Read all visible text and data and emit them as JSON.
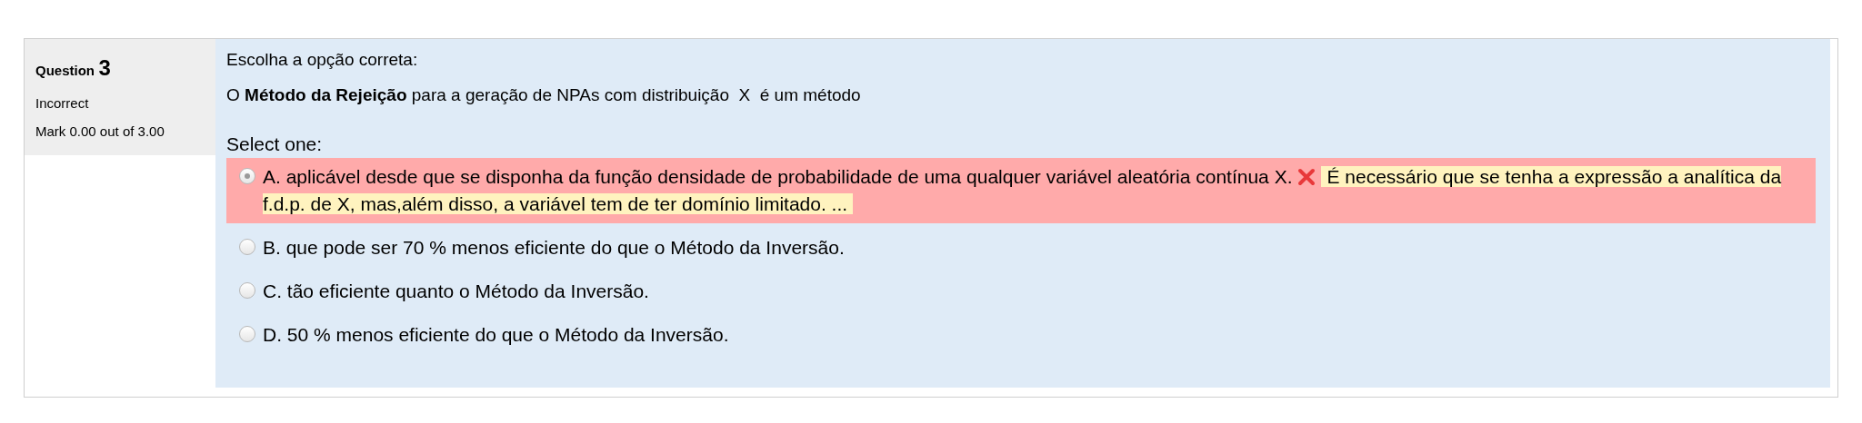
{
  "info": {
    "label": "Question",
    "number": "3",
    "status": "Incorrect",
    "mark": "Mark 0.00 out of 3.00"
  },
  "question": {
    "instruction": "Escolha a opção correta:",
    "text": "O **Método da Rejeição** para a geração de NPAs com distribuição  X  é um método",
    "prompt": "Select one:",
    "options": [
      {
        "text": "A. aplicável desde que se disponha da função densidade de probabilidade de uma qualquer variável aleatória contínua X.",
        "selected": true,
        "incorrect": true,
        "feedback": "É necessário que se tenha a expressão a analítica da f.d.p. de X, mas,além disso, a variável tem de ter domínio limitado. ..."
      },
      {
        "text": "B. que pode ser 70 % menos eficiente do que o Método da Inversão.",
        "selected": false,
        "incorrect": false
      },
      {
        "text": "C. tão eficiente quanto o Método da Inversão.",
        "selected": false,
        "incorrect": false
      },
      {
        "text": "D. 50 % menos eficiente do que o Método da Inversão.",
        "selected": false,
        "incorrect": false
      }
    ]
  }
}
